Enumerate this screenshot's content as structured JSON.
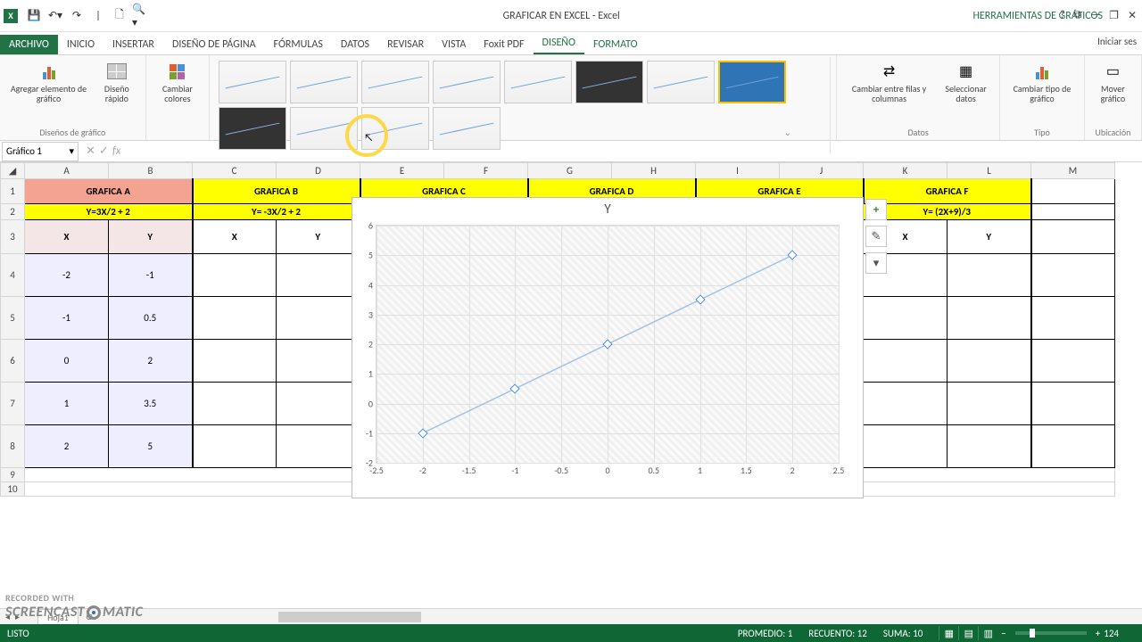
{
  "window": {
    "title": "GRAFICAR EN EXCEL - Excel",
    "context_tool": "HERRAMIENTAS DE GRÁFICOS",
    "signin": "Iniciar ses"
  },
  "qat": [
    "save",
    "undo",
    "redo",
    "touch",
    "new",
    "open",
    "preview"
  ],
  "tabs": {
    "file": "ARCHIVO",
    "list": [
      "INICIO",
      "INSERTAR",
      "DISEÑO DE PÁGINA",
      "FÓRMULAS",
      "DATOS",
      "REVISAR",
      "VISTA",
      "Foxit PDF"
    ],
    "context": [
      "DISEÑO",
      "FORMATO"
    ],
    "active": "DISEÑO"
  },
  "ribbon": {
    "group_layouts": "Diseños de gráfico",
    "add_element": "Agregar elemento de gráfico",
    "quick_layout": "Diseño rápido",
    "change_colors": "Cambiar colores",
    "group_data": "Datos",
    "switch_rowcol": "Cambiar entre filas y columnas",
    "select_data": "Seleccionar datos",
    "group_type": "Tipo",
    "change_type": "Cambiar tipo de gráfico",
    "group_location": "Ubicación",
    "move_chart": "Mover gráfico"
  },
  "namebox": "Gráfico 1",
  "columns": [
    "A",
    "B",
    "C",
    "D",
    "E",
    "F",
    "G",
    "H",
    "I",
    "J",
    "K",
    "L",
    "M"
  ],
  "rows": [
    "1",
    "2",
    "3",
    "4",
    "5",
    "6",
    "7",
    "8",
    "9",
    "10"
  ],
  "headers": {
    "A": "GRAFICA A",
    "B": "GRAFICA B",
    "C": "GRAFICA C",
    "D": "GRAFICA D",
    "E": "GRAFICA E",
    "F": "GRAFICA F"
  },
  "formulas": {
    "A": "Y=3X/2 + 2",
    "B": "Y= -3X/2  + 2",
    "F": "Y= (2X+9)/3"
  },
  "xyLabels": {
    "x": "X",
    "y": "Y"
  },
  "tableA": [
    {
      "x": "-2",
      "y": "-1"
    },
    {
      "x": "-1",
      "y": "0.5"
    },
    {
      "x": "0",
      "y": "2"
    },
    {
      "x": "1",
      "y": "3.5"
    },
    {
      "x": "2",
      "y": "5"
    }
  ],
  "chart_data": {
    "type": "scatter",
    "title": "Y",
    "x": [
      -2,
      -1,
      0,
      1,
      2
    ],
    "y": [
      -1,
      0.5,
      2,
      3.5,
      5
    ],
    "xlim": [
      -2.5,
      2.5
    ],
    "ylim": [
      -2,
      6
    ],
    "xticks": [
      -2.5,
      -2,
      -1.5,
      -1,
      -0.5,
      0,
      0.5,
      1,
      1.5,
      2,
      2.5
    ],
    "yticks": [
      -2,
      -1,
      0,
      1,
      2,
      3,
      4,
      5,
      6
    ]
  },
  "statusbar": {
    "ready": "LISTO",
    "avg": "PROMEDIO: 1",
    "count": "RECUENTO: 12",
    "sum": "SUMA: 10",
    "zoom": "124"
  },
  "sheet_tab": "Hoja1",
  "watermark": {
    "line1": "RECORDED WITH",
    "line2": "SCREENCAST",
    "line3": "MATIC"
  },
  "title_icons": [
    "?",
    "⧉",
    "—",
    "❐",
    "✕"
  ]
}
